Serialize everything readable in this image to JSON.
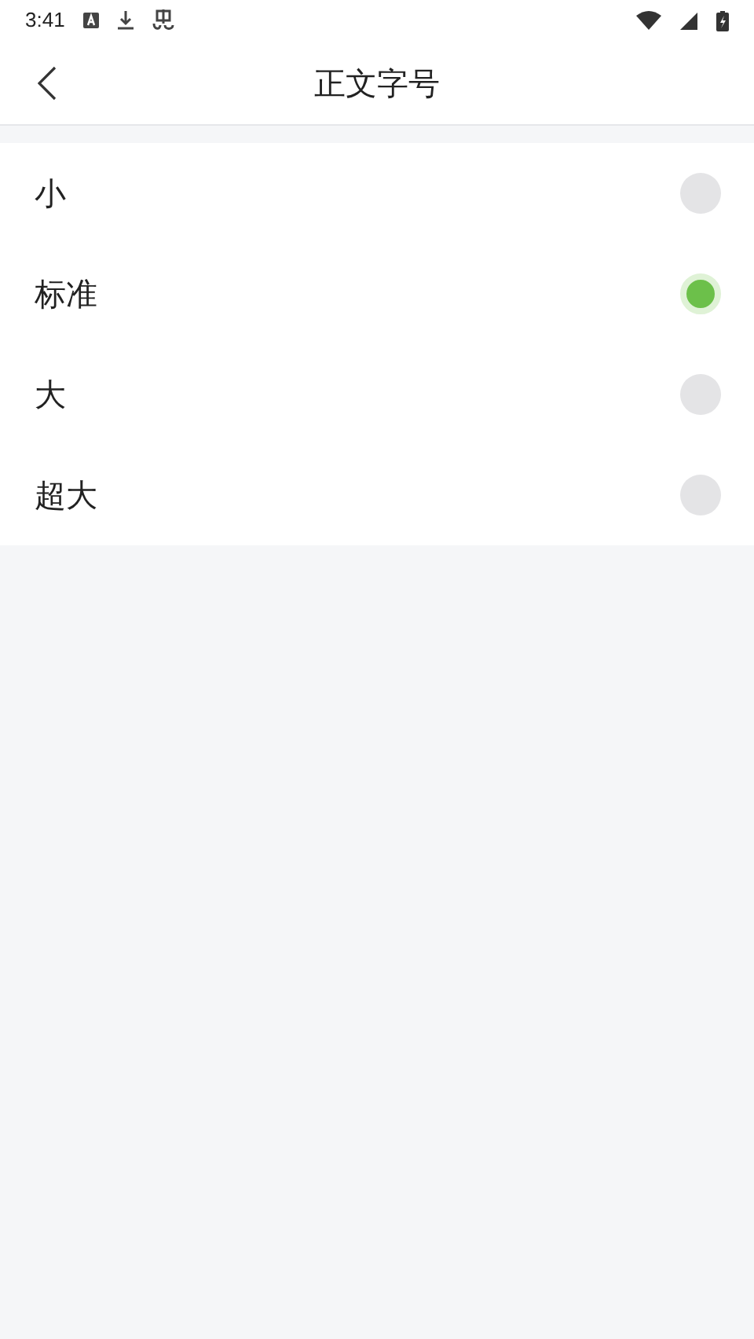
{
  "status_bar": {
    "time": "3:41"
  },
  "header": {
    "title": "正文字号"
  },
  "options": [
    {
      "label": "小",
      "selected": false
    },
    {
      "label": "标准",
      "selected": true
    },
    {
      "label": "大",
      "selected": false
    },
    {
      "label": "超大",
      "selected": false
    }
  ]
}
